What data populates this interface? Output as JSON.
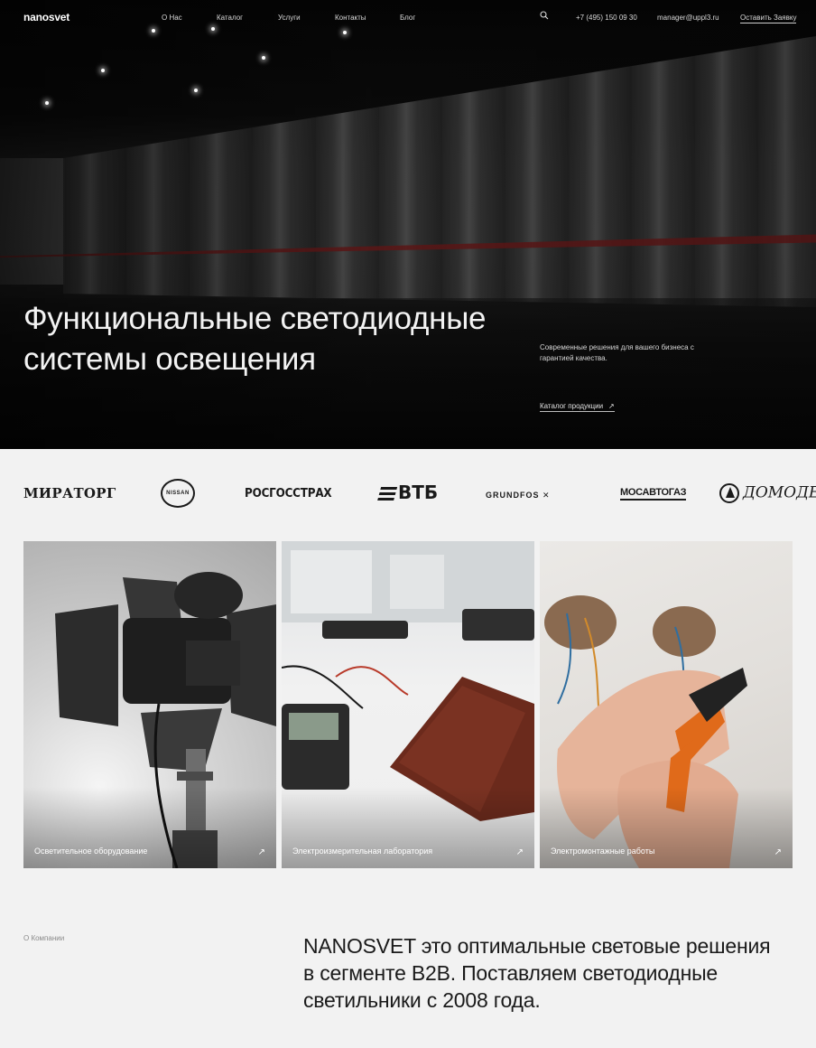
{
  "nav": {
    "logo": "nanosvet",
    "items": [
      "О Нас",
      "Каталог",
      "Услуги",
      "Контакты",
      "Блог"
    ],
    "phone": "+7 (495) 150 09 30",
    "email": "manager@uppl3.ru",
    "cta": "Оставить Заявку",
    "search_icon": "search-icon"
  },
  "hero": {
    "title": "Функциональные светодиодные системы освещения",
    "subtitle": "Современные решения для вашего бизнеса с гарантией качества.",
    "link": "Каталог продукции",
    "link_icon": "arrow-up-right-icon"
  },
  "brands": [
    "МИРАТОРГ",
    "NISSAN",
    "РОСГОССТРАХ",
    "ВТБ",
    "GRUNDFOS",
    "МОСАВТОГАЗ",
    "ДОМОДЕДОВО"
  ],
  "cards": [
    {
      "label": "Осветительное оборудование",
      "icon": "arrow-up-right-icon"
    },
    {
      "label": "Электроизмерительная лаборатория",
      "icon": "arrow-up-right-icon"
    },
    {
      "label": "Электромонтажные работы",
      "icon": "arrow-up-right-icon"
    }
  ],
  "about": {
    "label": "О Компании",
    "text": "NANOSVET это оптимальные световые решения в сегменте B2B. Поставляем светодиодные светильники с 2008 года."
  }
}
